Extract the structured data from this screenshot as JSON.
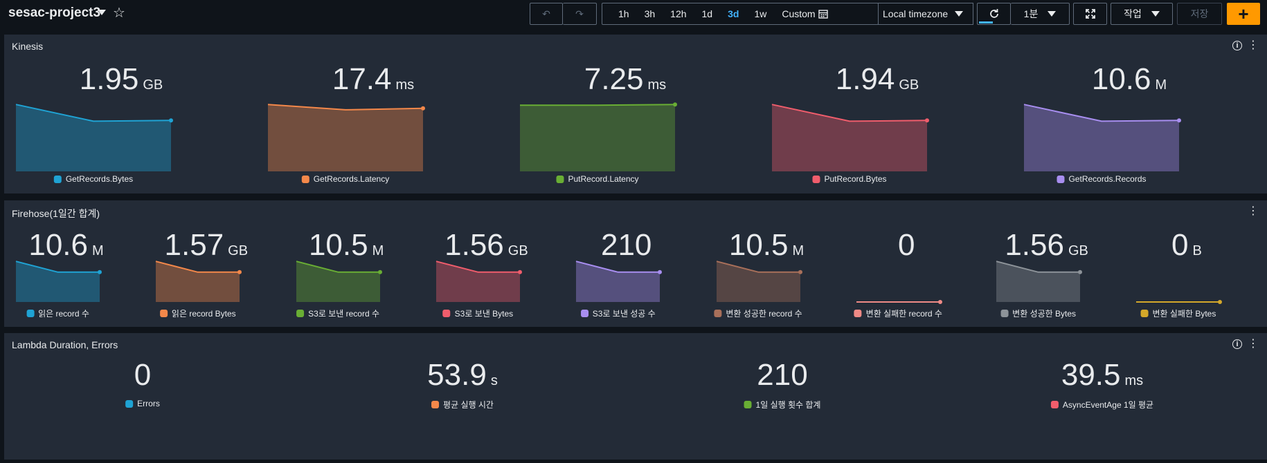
{
  "header": {
    "title": "sesac-project3",
    "time_ranges": [
      "1h",
      "3h",
      "12h",
      "1d",
      "3d",
      "1w"
    ],
    "active_range": "3d",
    "custom_label": "Custom",
    "timezone": "Local timezone",
    "refresh_interval": "1분",
    "actions_label": "작업",
    "save_label": "저장",
    "add_label": "+"
  },
  "kinesis": {
    "title": "Kinesis",
    "widgets": [
      {
        "value": "1.95",
        "unit": "GB",
        "legend": "GetRecords.Bytes",
        "color": "#1fa3d4",
        "trend": [
          0.88,
          0.66,
          0.67
        ]
      },
      {
        "value": "17.4",
        "unit": "ms",
        "legend": "GetRecords.Latency",
        "color": "#f4884a",
        "trend": [
          0.88,
          0.81,
          0.83
        ]
      },
      {
        "value": "7.25",
        "unit": "ms",
        "legend": "PutRecord.Latency",
        "color": "#69ae34",
        "trend": [
          0.87,
          0.87,
          0.88
        ]
      },
      {
        "value": "1.94",
        "unit": "GB",
        "legend": "PutRecord.Bytes",
        "color": "#f05d6c",
        "trend": [
          0.88,
          0.66,
          0.67
        ]
      },
      {
        "value": "10.6",
        "unit": "M",
        "legend": "GetRecords.Records",
        "color": "#a88ef0",
        "trend": [
          0.88,
          0.66,
          0.67
        ]
      }
    ]
  },
  "firehose": {
    "title": "Firehose(1일간 합계)",
    "widgets": [
      {
        "value": "10.6",
        "unit": "M",
        "legend": "읽은 record 수",
        "color": "#1fa3d4",
        "trend": [
          0.98,
          0.72,
          0.72
        ]
      },
      {
        "value": "1.57",
        "unit": "GB",
        "legend": "읽은 record Bytes",
        "color": "#f4884a",
        "trend": [
          0.98,
          0.72,
          0.72
        ]
      },
      {
        "value": "10.5",
        "unit": "M",
        "legend": "S3로 보낸 record 수",
        "color": "#69ae34",
        "trend": [
          0.98,
          0.72,
          0.72
        ]
      },
      {
        "value": "1.56",
        "unit": "GB",
        "legend": "S3로 보낸 Bytes",
        "color": "#f05d6c",
        "trend": [
          0.98,
          0.72,
          0.72
        ]
      },
      {
        "value": "210",
        "unit": "",
        "legend": "S3로 보낸 성공 수",
        "color": "#a88ef0",
        "trend": [
          0.98,
          0.72,
          0.72
        ]
      },
      {
        "value": "10.5",
        "unit": "M",
        "legend": "변환 성공한 record 수",
        "color": "#a9705a",
        "trend": [
          0.98,
          0.72,
          0.72
        ]
      },
      {
        "value": "0",
        "unit": "",
        "legend": "변환 실패한 record 수",
        "color": "#ef8a86",
        "trend": [
          0,
          0,
          0
        ]
      },
      {
        "value": "1.56",
        "unit": "GB",
        "legend": "변환 성공한 Bytes",
        "color": "#8d9399",
        "trend": [
          0.98,
          0.72,
          0.72
        ]
      },
      {
        "value": "0",
        "unit": "B",
        "legend": "변환 실패한 Bytes",
        "color": "#d4a82a",
        "trend": [
          0,
          0,
          0
        ]
      }
    ]
  },
  "lambda": {
    "title": "Lambda Duration, Errors",
    "widgets": [
      {
        "value": "0",
        "unit": "",
        "legend": "Errors",
        "color": "#1fa3d4"
      },
      {
        "value": "53.9",
        "unit": "s",
        "legend": "평균 실행 시간",
        "color": "#f4884a"
      },
      {
        "value": "210",
        "unit": "",
        "legend": "1일 실행 횟수 합계",
        "color": "#69ae34"
      },
      {
        "value": "39.5",
        "unit": "ms",
        "legend": "AsyncEventAge 1일 평균",
        "color": "#f05d6c"
      }
    ]
  }
}
